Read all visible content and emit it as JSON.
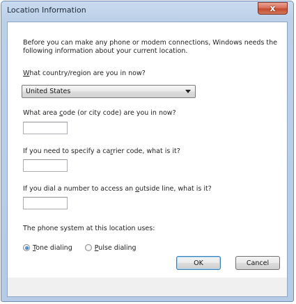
{
  "window": {
    "title": "Location Information",
    "close_label": "x"
  },
  "intro_text": "Before you can make any phone or modem connections, Windows needs the following information about your current location.",
  "country": {
    "label_accel": "W",
    "label_rest": "hat country/region are you in now?",
    "selected": "United States"
  },
  "area_code": {
    "label_pre": "What area ",
    "label_accel": "c",
    "label_post": "ode (or city code) are you in now?",
    "value": ""
  },
  "carrier_code": {
    "label_pre": "If you need to specify a ca",
    "label_accel": "r",
    "label_post": "rier code, what is it?",
    "value": ""
  },
  "outside_line": {
    "label_pre": "If you dial a number to access an ",
    "label_accel": "o",
    "label_post": "utside line, what is it?",
    "value": ""
  },
  "phone_system": {
    "label": "The phone system at this location uses:",
    "tone": {
      "accel": "T",
      "rest": "one dialing",
      "selected": true
    },
    "pulse": {
      "accel": "P",
      "rest": "ulse dialing",
      "selected": false
    }
  },
  "buttons": {
    "ok": "OK",
    "cancel": "Cancel"
  }
}
